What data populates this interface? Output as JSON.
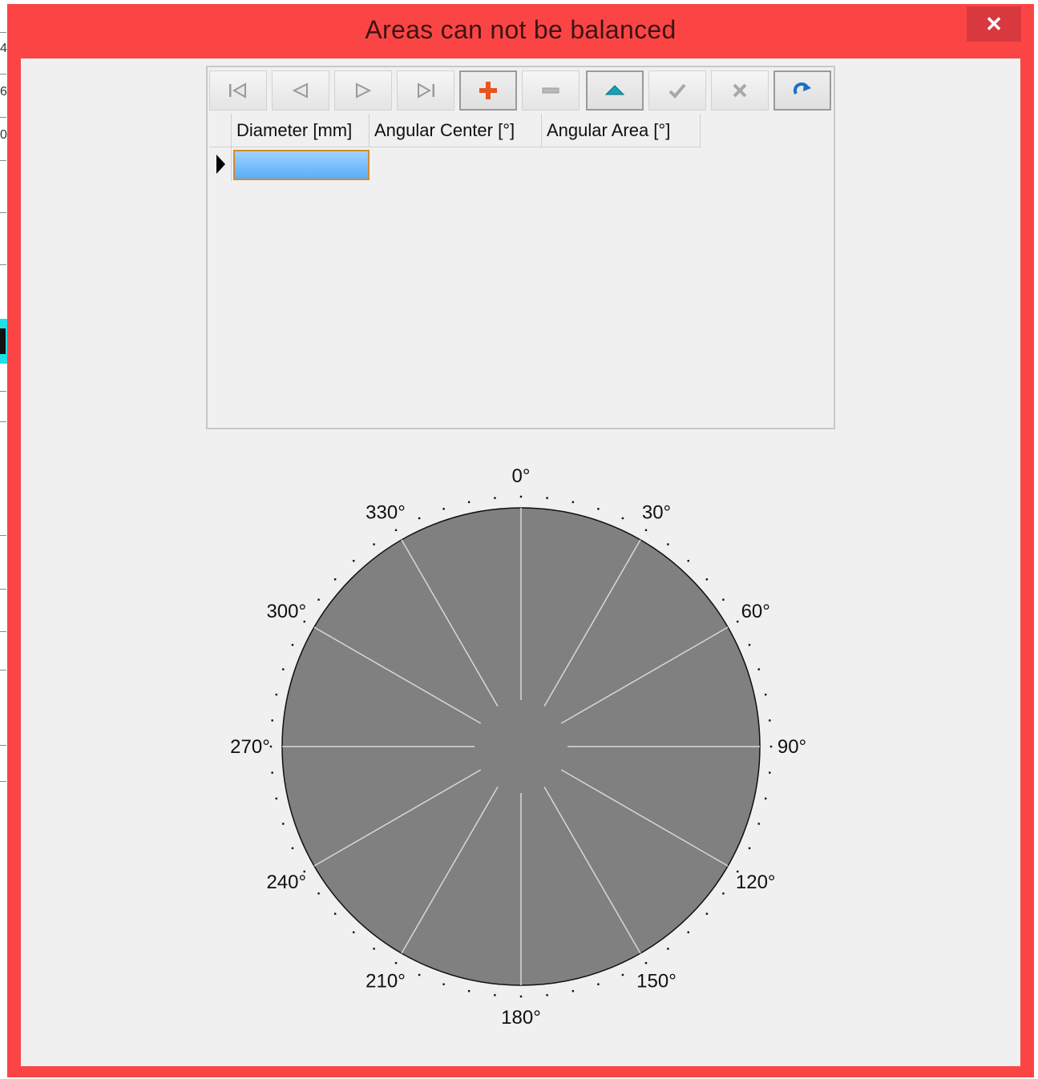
{
  "window": {
    "title": "Areas can not be balanced",
    "close_glyph": "✕"
  },
  "background_app": {
    "glyphs": [
      "4",
      "6",
      "0"
    ]
  },
  "navigator": {
    "buttons": [
      {
        "name": "first",
        "icon": "first-record-icon"
      },
      {
        "name": "prior",
        "icon": "prior-record-icon"
      },
      {
        "name": "next",
        "icon": "next-record-icon"
      },
      {
        "name": "last",
        "icon": "last-record-icon"
      },
      {
        "name": "insert",
        "icon": "plus-icon"
      },
      {
        "name": "delete",
        "icon": "minus-icon"
      },
      {
        "name": "edit",
        "icon": "up-triangle-icon"
      },
      {
        "name": "post",
        "icon": "checkmark-icon"
      },
      {
        "name": "cancel",
        "icon": "x-icon"
      },
      {
        "name": "refresh",
        "icon": "refresh-icon"
      }
    ]
  },
  "grid": {
    "columns": [
      "Diameter [mm]",
      "Angular Center [°]",
      "Angular Area [°]"
    ],
    "rows": [
      [
        "",
        "",
        ""
      ]
    ]
  },
  "polar": {
    "angle_labels": [
      "0°",
      "30°",
      "60°",
      "90°",
      "120°",
      "150°",
      "180°",
      "210°",
      "240°",
      "270°",
      "300°",
      "330°"
    ],
    "spoke_step_deg": 30,
    "minor_tick_step_deg": 6,
    "colors": {
      "fill": "#808080",
      "spokes": "#d8d8d8",
      "outline": "#101010",
      "ticks": "#101010"
    }
  },
  "colors": {
    "window_frame": "#fb4545",
    "client": "#f0f0f0",
    "selection": "#6ab6f9",
    "selection_border": "#d58a2f"
  }
}
